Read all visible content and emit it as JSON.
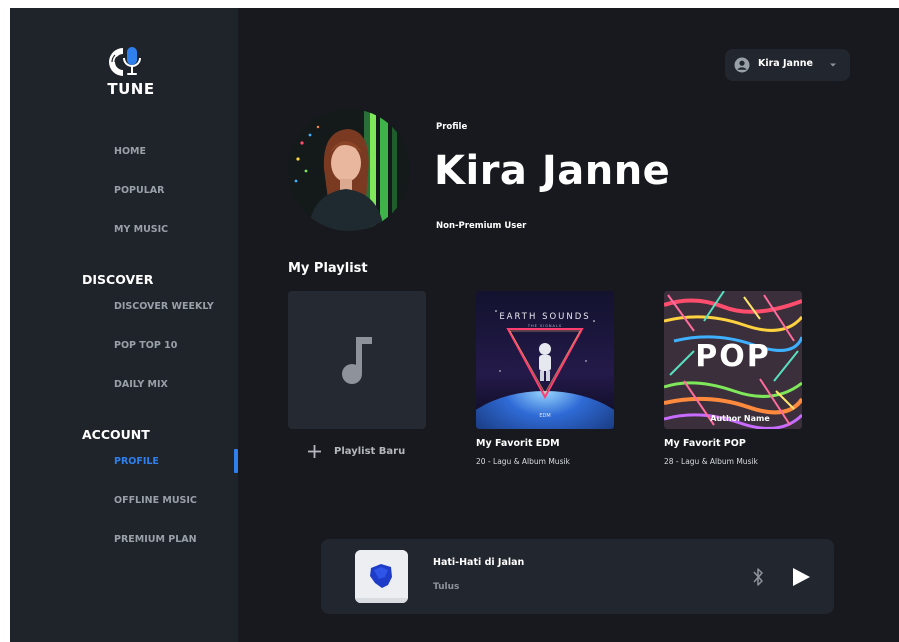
{
  "brand": {
    "name": "TUNE",
    "accent": "#2f80ed"
  },
  "sidebar": {
    "main_items": [
      {
        "label": "HOME"
      },
      {
        "label": "POPULAR"
      },
      {
        "label": "MY MUSIC"
      }
    ],
    "discover": {
      "title": "DISCOVER",
      "items": [
        {
          "label": "DISCOVER WEEKLY"
        },
        {
          "label": "POP TOP 10"
        },
        {
          "label": "DAILY MIX"
        }
      ]
    },
    "account": {
      "title": "ACCOUNT",
      "items": [
        {
          "label": "PROFILE",
          "active": true
        },
        {
          "label": "OFFLINE MUSIC"
        },
        {
          "label": "PREMIUM PLAN"
        }
      ]
    }
  },
  "user_menu": {
    "name": "Kira Janne",
    "icon": "user-circle-icon",
    "caret": "caret-down-icon"
  },
  "profile": {
    "label": "Profile",
    "name": "Kira Janne",
    "status": "Non-Premium User"
  },
  "playlist": {
    "title": "My Playlist",
    "new_label": "Playlist Baru",
    "items": [
      {
        "title": "My Favorit EDM",
        "meta": "20 - Lagu & Album Musik",
        "cover_heading": "EARTH SOUNDS",
        "cover_sub": "THE SIGNALS",
        "cover_tag": "EDM"
      },
      {
        "title": "My Favorit POP",
        "meta": "28 - Lagu & Album Musik",
        "cover_heading": "POP",
        "cover_sub": "Author Name"
      }
    ]
  },
  "player": {
    "track": "Hati-Hati di Jalan",
    "artist": "Tulus",
    "icons": [
      "bluetooth-icon",
      "play-icon"
    ]
  }
}
